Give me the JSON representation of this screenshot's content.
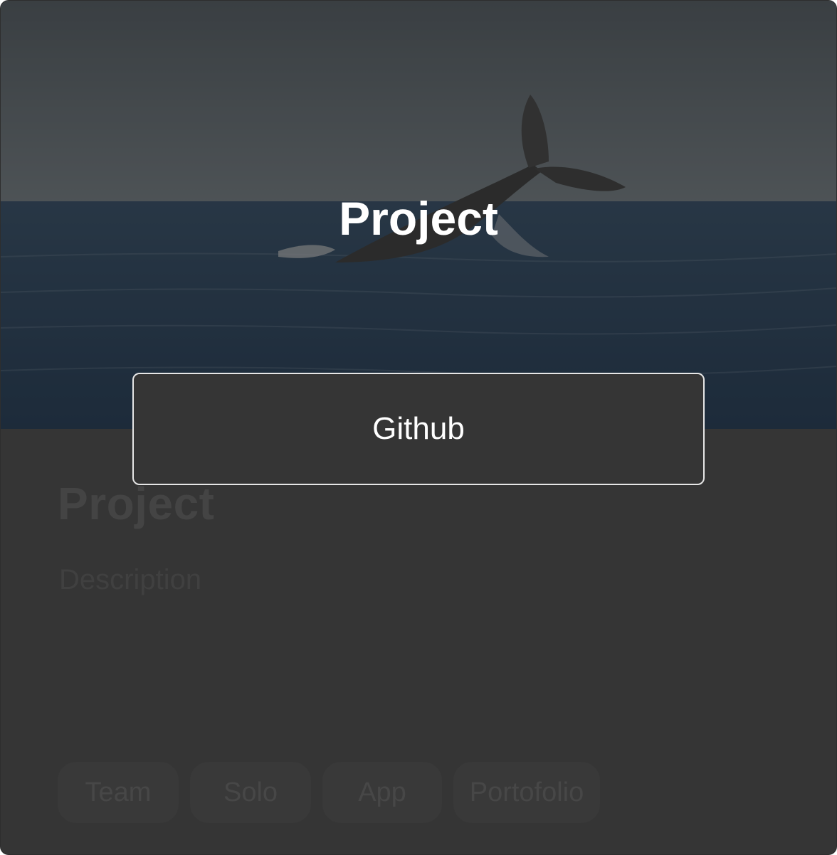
{
  "card": {
    "title": "Project",
    "description": "Description",
    "tags": [
      "Team",
      "Solo",
      "App",
      "Portofolio"
    ]
  },
  "overlay": {
    "title": "Project",
    "button_label": "Github"
  },
  "hero": {
    "image_subject": "whale-tail-image"
  },
  "colors": {
    "card_background": "#353535",
    "overlay_text": "#ffffff",
    "button_border": "#e6e6e6",
    "muted_text": "#444444"
  }
}
